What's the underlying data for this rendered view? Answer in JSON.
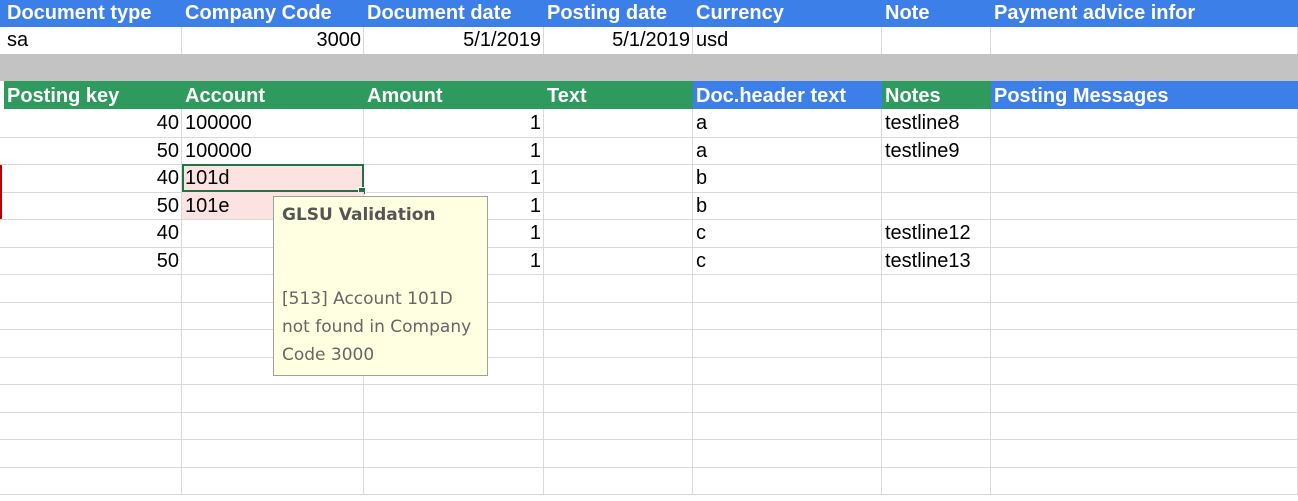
{
  "header_section": {
    "columns": [
      "Document type",
      "Company Code",
      "Document date",
      "Posting date",
      "Currency",
      "Note",
      "Payment advice infor"
    ],
    "values": [
      "sa",
      "3000",
      "5/1/2019",
      "5/1/2019",
      "usd",
      "",
      ""
    ]
  },
  "items_section": {
    "columns": [
      "Posting key",
      "Account",
      "Amount",
      "Text",
      "Doc.header text",
      "Notes",
      "Posting Messages"
    ],
    "rows": [
      {
        "posting_key": "40",
        "account": "100000",
        "amount": "1",
        "text": "",
        "doc_header_text": "a",
        "notes": "testline8",
        "posting_messages": ""
      },
      {
        "posting_key": "50",
        "account": "100000",
        "amount": "1",
        "text": "",
        "doc_header_text": "a",
        "notes": "testline9",
        "posting_messages": ""
      },
      {
        "posting_key": "40",
        "account": "101d",
        "amount": "1",
        "text": "",
        "doc_header_text": "b",
        "notes": "",
        "posting_messages": ""
      },
      {
        "posting_key": "50",
        "account": "101e",
        "amount": "1",
        "text": "",
        "doc_header_text": "b",
        "notes": "",
        "posting_messages": ""
      },
      {
        "posting_key": "40",
        "account": "",
        "amount": "1",
        "text": "",
        "doc_header_text": "c",
        "notes": "testline12",
        "posting_messages": ""
      },
      {
        "posting_key": "50",
        "account": "",
        "amount": "1",
        "text": "",
        "doc_header_text": "c",
        "notes": "testline13",
        "posting_messages": ""
      }
    ]
  },
  "tooltip": {
    "title": "GLSU Validation",
    "message": "[513] Account 101D not found in Company Code 3000"
  },
  "colors": {
    "header_blue": "#3d7fe8",
    "header_green": "#2f9a5e",
    "error_pink": "#fde2e2",
    "selection_green": "#217346",
    "tooltip_bg": "#ffffe1"
  }
}
